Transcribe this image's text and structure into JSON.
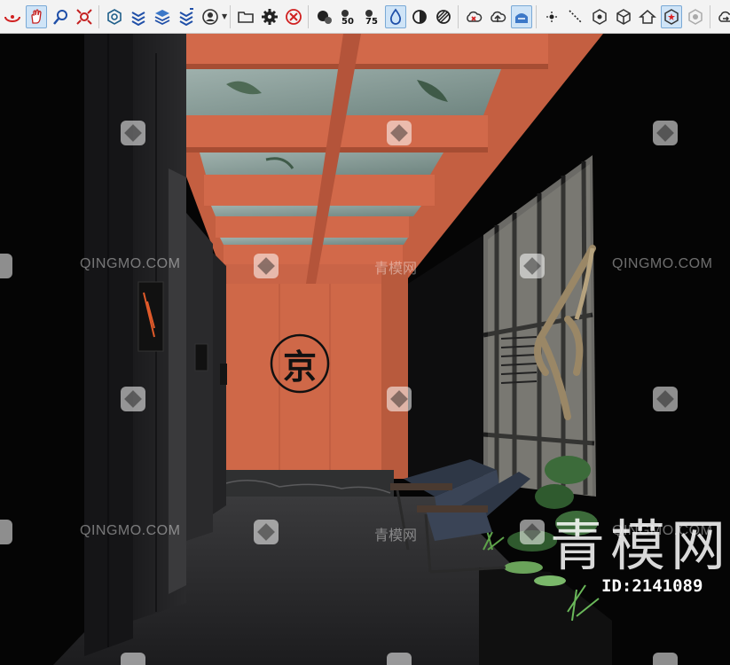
{
  "toolbar": {
    "tools": [
      {
        "name": "orbit-icon"
      },
      {
        "name": "pan-hand-icon",
        "active": true
      },
      {
        "name": "zoom-icon"
      },
      {
        "name": "zoom-extents-icon"
      },
      {
        "name": "section-plane-icon"
      },
      {
        "name": "layers-stack-icon"
      },
      {
        "name": "layers-stack-alt-icon"
      },
      {
        "name": "layers-stack-sorted-icon"
      },
      {
        "name": "user-profile-icon"
      },
      {
        "name": "folder-icon"
      },
      {
        "name": "gear-icon"
      },
      {
        "name": "cancel-circle-icon"
      },
      {
        "name": "model-info-icon"
      },
      {
        "name": "count-50-icon",
        "label": "50"
      },
      {
        "name": "count-75-icon",
        "label": "75"
      },
      {
        "name": "water-drop-icon",
        "active": true
      },
      {
        "name": "contrast-icon"
      },
      {
        "name": "hatch-icon"
      },
      {
        "name": "cloud-delete-icon"
      },
      {
        "name": "cloud-upload-icon"
      },
      {
        "name": "cloud-manage-icon",
        "active": true
      },
      {
        "name": "dot-point-icon"
      },
      {
        "name": "dotted-line-icon"
      },
      {
        "name": "gear-cube-icon"
      },
      {
        "name": "cube-outline-icon"
      },
      {
        "name": "home-cube-icon"
      },
      {
        "name": "cube-star-icon",
        "active": true
      },
      {
        "name": "cube-faded-icon"
      },
      {
        "name": "cloud-arrow-icon"
      },
      {
        "name": "cloud-sync-icon"
      }
    ]
  },
  "scene": {
    "emblem_char": "京",
    "watermark_en": "QINGMO.COM",
    "watermark_cn": "青模网",
    "brand_big": "青模网",
    "id_text": "ID:2141089"
  },
  "colors": {
    "terracotta": "#d2694a",
    "terracotta_dark": "#b4543a",
    "wall_dark": "#1f1f21",
    "floor": "#2b2b2d"
  }
}
